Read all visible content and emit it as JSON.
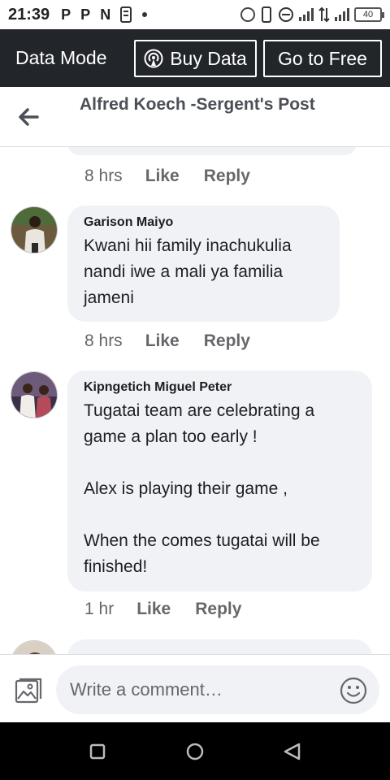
{
  "status_bar": {
    "time": "21:39",
    "notification_icons": [
      "P",
      "P",
      "N"
    ],
    "battery": "40"
  },
  "data_bar": {
    "label": "Data Mode",
    "buy_data_label": "Buy Data",
    "go_free_label": "Go to Free"
  },
  "header": {
    "title": "Alfred Koech -Sergent's Post"
  },
  "comments": [
    {
      "author": "",
      "text": "",
      "time": "8 hrs",
      "like": "Like",
      "reply": "Reply"
    },
    {
      "author": "Garison Maiyo",
      "text": "Kwani hii family inachukulia nandi iwe a mali ya familia jameni",
      "time": "8 hrs",
      "like": "Like",
      "reply": "Reply"
    },
    {
      "author": "Kipngetich Miguel Peter",
      "text": "Tugatai team are celebrating a game a plan too early !\n\nAlex is playing their game ,\n\nWhen the comes tugatai will be finished!",
      "time": "1 hr",
      "like": "Like",
      "reply": "Reply"
    }
  ],
  "composer": {
    "placeholder": "Write a comment…"
  },
  "colors": {
    "data_bar_bg": "#22262b",
    "bubble_bg": "#f0f2f5",
    "meta_text": "#65676b",
    "title_text": "#4b4f56"
  }
}
